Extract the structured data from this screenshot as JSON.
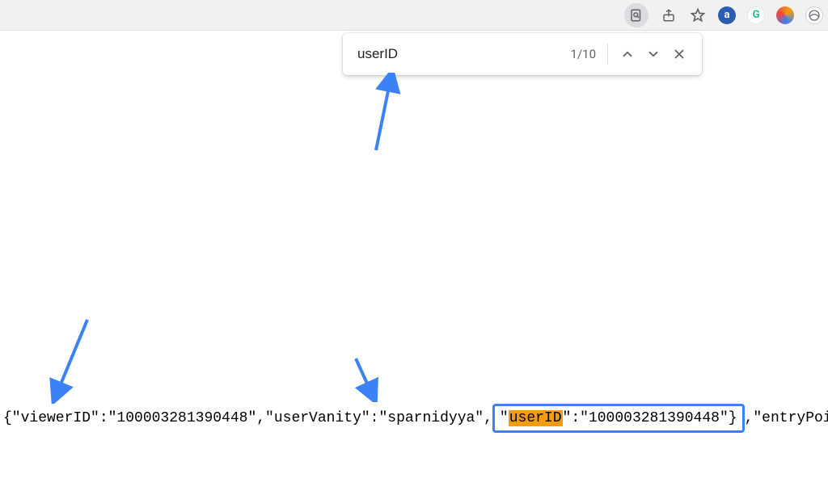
{
  "toolbar": {
    "find_tool_name": "find-in-page-icon",
    "share_name": "share-icon",
    "bookmark_name": "star-icon",
    "extensions": [
      {
        "letter": "a",
        "name": "extension-a"
      },
      {
        "letter": "G",
        "name": "extension-grammarly"
      },
      {
        "letter": "",
        "name": "extension-similarweb"
      },
      {
        "letter": "e",
        "name": "extension-e"
      }
    ]
  },
  "find_bar": {
    "query": "userID",
    "count": "1/10",
    "prev_name": "previous-match",
    "next_name": "next-match",
    "close_name": "close-find"
  },
  "code": {
    "pre1": "{\"viewerID\":\"100003281390448\",\"userVanity\":\"sparnidyya\",",
    "boxed_prefix": "\"",
    "boxed_match": "userID",
    "boxed_suffix": "\":\"100003281390448\"}",
    "post1": ",\"entryPoint\":{\"__dr\""
  }
}
